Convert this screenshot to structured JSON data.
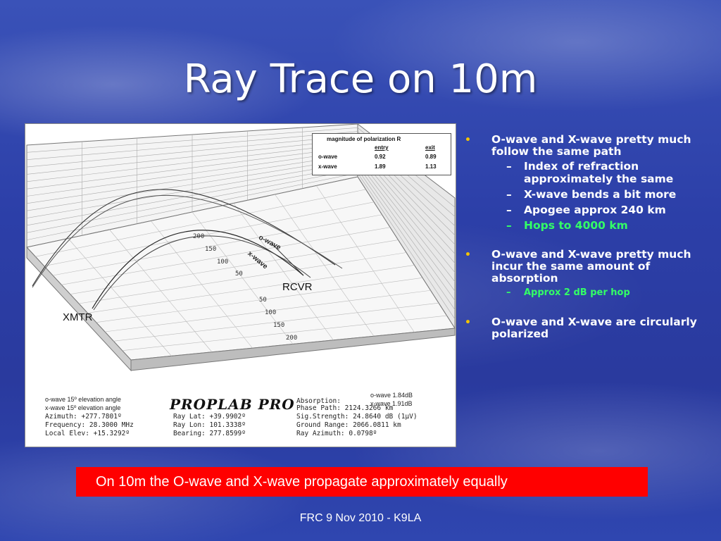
{
  "slide": {
    "title": "Ray Trace on 10m",
    "banner": "On 10m the O-wave and X-wave propagate approximately equally",
    "footer": "FRC 9 Nov 2010 - K9LA"
  },
  "bullets": [
    {
      "text": "O-wave and X-wave pretty much follow the same path",
      "sub": [
        {
          "text": "Index of refraction approximately the same",
          "color": "white"
        },
        {
          "text": "X-wave bends a bit more",
          "color": "white"
        },
        {
          "text": "Apogee approx 240 km",
          "color": "white"
        },
        {
          "text": "Hops to 4000 km",
          "color": "green"
        }
      ]
    },
    {
      "text": "O-wave and X-wave pretty much incur the same amount of absorption",
      "sub": [
        {
          "text": "Approx 2 dB per hop",
          "color": "green"
        }
      ]
    },
    {
      "text": "O-wave and X-wave are circularly polarized",
      "sub": []
    }
  ],
  "figure": {
    "legend": {
      "title": "magnitude of polarization R",
      "col_entry": "entry",
      "col_exit": "exit",
      "rows": [
        {
          "name": "o-wave",
          "entry": "0.92",
          "exit": "0.89"
        },
        {
          "name": "x-wave",
          "entry": "1.89",
          "exit": "1.13"
        }
      ]
    },
    "labels": {
      "owave": "o-wave",
      "xwave": "x-wave",
      "rcvr": "RCVR",
      "xmtr": "XMTR"
    },
    "height_ticks": [
      "200",
      "150",
      "100",
      "50"
    ],
    "range_ticks": [
      "50",
      "100",
      "150",
      "200"
    ],
    "logo": "PROPLAB PRO",
    "elev_o": "o-wave 15º elevation angle",
    "elev_x": "x-wave 15º elevation angle",
    "absorption_label": "Absorption:",
    "absorption_o": "o-wave 1.84dB",
    "absorption_x": "x-wave 1.91dB",
    "readouts_left": [
      "Azimuth:  +277.7801º",
      "Frequency:  28.3000 MHz",
      "Local Elev: +15.3292º"
    ],
    "readouts_mid": [
      "Ray Lat:  +39.9902º",
      "Ray Lon:  101.3338º",
      "Bearing:  277.8599º"
    ],
    "readouts_right": [
      "Phase Path:   2124.3266 km",
      "Sig.Strength:   24.8640 dB (1µV)",
      "Ground Range:  2066.0811 km",
      "Ray Azimuth:      0.0798º"
    ]
  }
}
